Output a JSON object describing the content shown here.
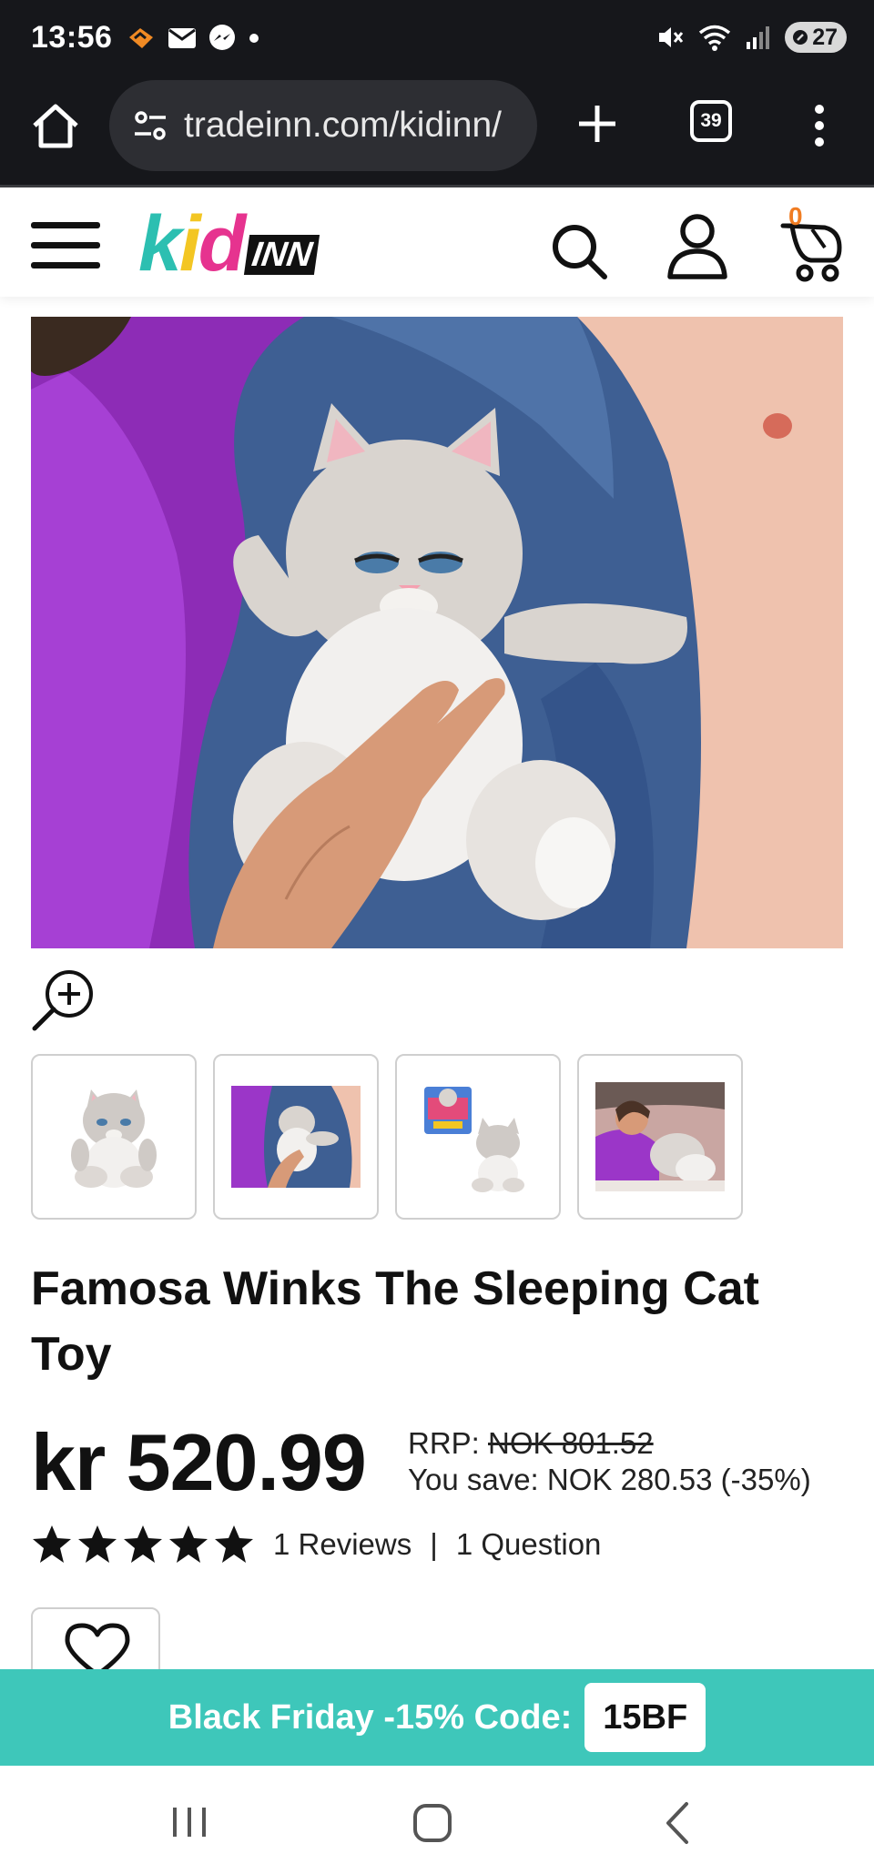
{
  "status_bar": {
    "time": "13:56",
    "battery": "27",
    "icons": [
      "heart-notification-icon",
      "mail-icon",
      "messenger-icon",
      "dot-icon",
      "mute-icon",
      "wifi-icon",
      "signal-icon"
    ]
  },
  "browser": {
    "url": "tradeinn.com/kidinn/",
    "tab_count": "39"
  },
  "site_header": {
    "logo_kid": "kid",
    "logo_inn": "INN",
    "cart_count": "0"
  },
  "product": {
    "title": "Famosa Winks The Sleeping Cat Toy",
    "price": "kr 520.99",
    "rrp_label": "RRP: ",
    "rrp_value": "NOK 801.52",
    "you_save": "You save: NOK 280.53 (-35%)",
    "rating_stars": 5,
    "reviews": "1 Reviews",
    "separator": "|",
    "questions": "1 Question",
    "thumbnails": [
      "thumbnail-1",
      "thumbnail-2",
      "thumbnail-3",
      "thumbnail-4"
    ]
  },
  "promo": {
    "text": "Black Friday -15% Code:",
    "code": "15BF"
  },
  "colors": {
    "teal_brand": "#3ec7ba",
    "cart_orange": "#f07c22",
    "dark_bar": "#16171b"
  }
}
